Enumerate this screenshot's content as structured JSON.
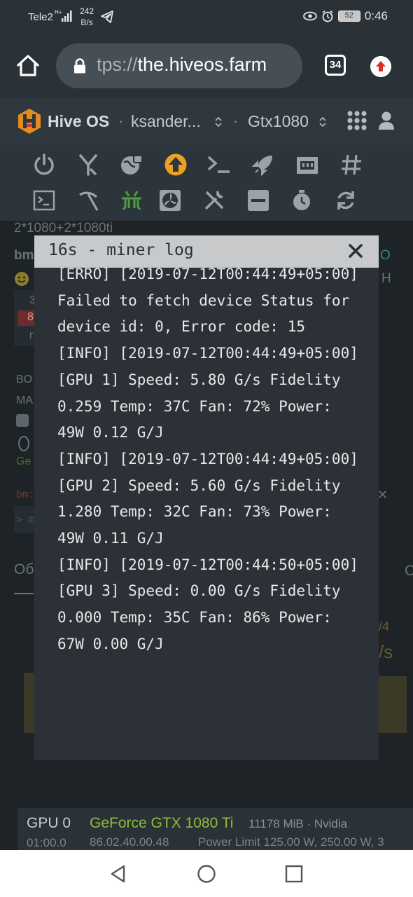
{
  "statusbar": {
    "carrier": "Tele2",
    "net_speed_value": "242",
    "net_speed_unit": "B/s",
    "battery": "52",
    "time": "0:46",
    "icons": [
      "signal-icon",
      "telegram-icon",
      "eye-icon",
      "alarm-icon",
      "battery-icon"
    ]
  },
  "browser": {
    "url_scheme_fragment": "tps://",
    "url_host": "the.hiveos.farm",
    "tab_count": "34"
  },
  "hive": {
    "title": "Hive OS",
    "separator": "·",
    "farm": "ksander...",
    "worker": "Gtx1080"
  },
  "background": {
    "worker_desc": "2*1080+2*1080ti",
    "frag_bm": "bm",
    "frag_o": "O",
    "frag_h": "H",
    "frag_3": "3",
    "frag_8": "8",
    "frag_r": "r",
    "frag_bo": "BO",
    "frag_ma": "MA",
    "frag_ge": "Ge",
    "frag_bm2": "bm:",
    "frag_gt": "> m",
    "frag_ob": "Об",
    "frag_c": "C",
    "frag_slash4": "/4",
    "frag_s": "/s"
  },
  "modal": {
    "title": "16s - miner log",
    "log": "[ERRO] [2019-07-12T00:44:49+05:00] Failed to fetch device Status for device id: 0, Error code: 15\n[INFO] [2019-07-12T00:44:49+05:00] [GPU 1] Speed: 5.80 G/s Fidelity 0.259 Temp: 37C Fan: 72% Power: 49W 0.12 G/J\n[INFO] [2019-07-12T00:44:49+05:00] [GPU 2] Speed: 5.60 G/s Fidelity 1.280 Temp: 32C Fan: 73% Power: 49W 0.11 G/J\n[INFO] [2019-07-12T00:44:50+05:00] [GPU 3] Speed: 0.00 G/s Fidelity 0.000 Temp: 35C Fan: 86% Power: 67W 0.00 G/J"
  },
  "gpu": {
    "label": "GPU 0",
    "time": "01:00.0",
    "name": "GeForce GTX 1080 Ti",
    "memory": "11178 MiB · Nvidia",
    "bios": "86.02.40.00.48",
    "power": "Power Limit 125.00 W, 250.00 W, 3"
  },
  "colors": {
    "accent_orange": "#f0a020",
    "accent_green": "#8fbc3b",
    "error_red": "#c0392b"
  }
}
